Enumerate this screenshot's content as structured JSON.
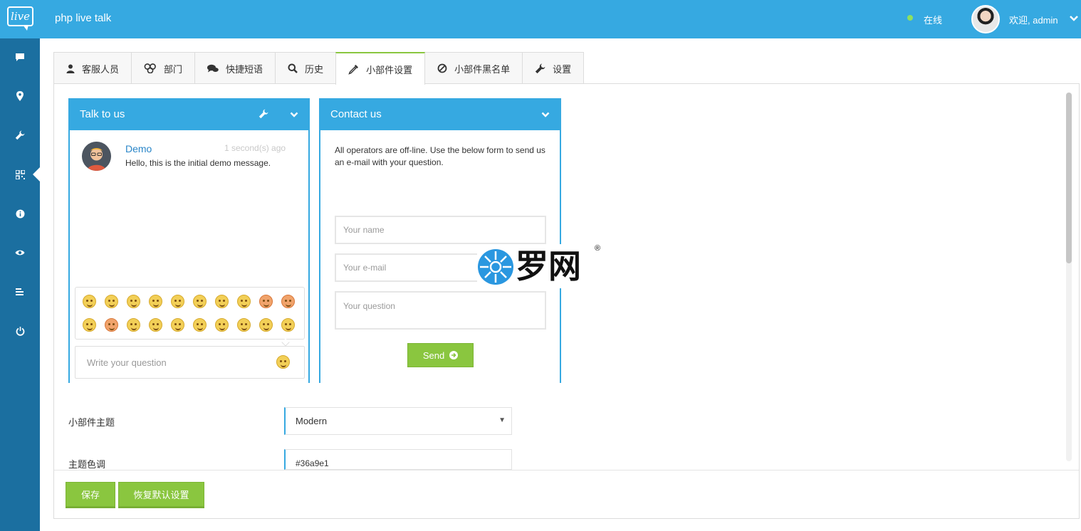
{
  "header": {
    "logo_text": "live",
    "app_title": "php live talk",
    "status": "在线",
    "welcome": "欢迎, admin"
  },
  "sidebar": {
    "items": [
      {
        "icon": "chat-icon"
      },
      {
        "icon": "map-marker-icon"
      },
      {
        "icon": "wrench-icon",
        "active": true
      },
      {
        "icon": "qrcode-icon"
      },
      {
        "icon": "info-icon"
      },
      {
        "icon": "eye-icon"
      },
      {
        "icon": "list-icon"
      },
      {
        "icon": "power-icon"
      }
    ]
  },
  "tabs": [
    {
      "label": "客服人员",
      "icon": "user-icon"
    },
    {
      "label": "部门",
      "icon": "group-icon"
    },
    {
      "label": "快捷短语",
      "icon": "comments-icon"
    },
    {
      "label": "历史",
      "icon": "search-icon"
    },
    {
      "label": "小部件设置",
      "icon": "eyedropper-icon",
      "active": true
    },
    {
      "label": "小部件黑名单",
      "icon": "ban-icon"
    },
    {
      "label": "设置",
      "icon": "wrench-icon"
    }
  ],
  "talk_widget": {
    "title": "Talk to us",
    "message_name": "Demo",
    "message_time": "1 second(s) ago",
    "message_text": "Hello, this is the initial demo message.",
    "question_placeholder": "Write your question"
  },
  "contact_widget": {
    "title": "Contact us",
    "offline_text": "All operators are off-line. Use the below form to send us an e-mail with your question.",
    "name_placeholder": "Your name",
    "email_placeholder": "Your e-mail",
    "question_placeholder": "Your question",
    "send_label": "Send"
  },
  "watermark": {
    "text": "罗网",
    "registered": "®"
  },
  "form": {
    "theme_label": "小部件主题",
    "theme_value": "Modern",
    "color_label": "主题色调",
    "color_value": "#36a9e1"
  },
  "actions": {
    "save_label": "保存",
    "reset_label": "恢复默认设置"
  },
  "colors": {
    "primary": "#36a9e1",
    "sidebar": "#1b6fa0",
    "button_green": "#8ac63f",
    "online": "#8ee05f"
  }
}
